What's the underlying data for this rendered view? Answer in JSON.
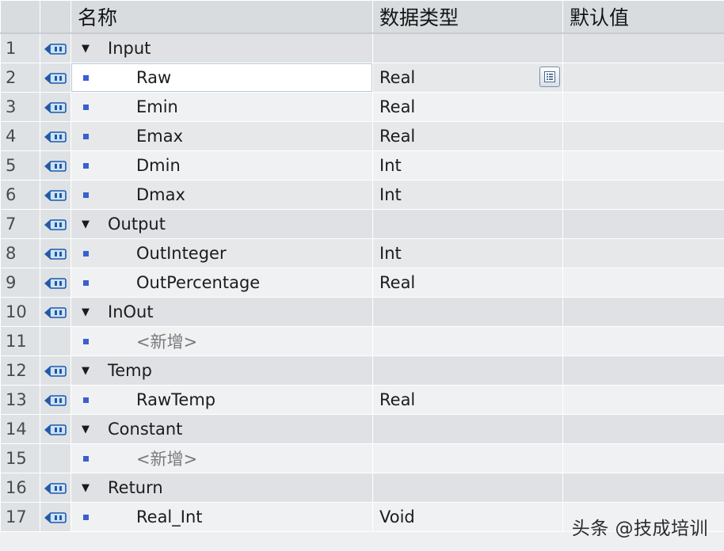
{
  "headers": {
    "name": "名称",
    "data_type": "数据类型",
    "default_value": "默认值"
  },
  "rows": [
    {
      "num": "1",
      "kind": "section",
      "name": "Input",
      "type": ""
    },
    {
      "num": "2",
      "kind": "var",
      "name": "Raw",
      "type": "Real",
      "selected": true
    },
    {
      "num": "3",
      "kind": "var",
      "name": "Emin",
      "type": "Real"
    },
    {
      "num": "4",
      "kind": "var",
      "name": "Emax",
      "type": "Real"
    },
    {
      "num": "5",
      "kind": "var",
      "name": "Dmin",
      "type": "Int"
    },
    {
      "num": "6",
      "kind": "var",
      "name": "Dmax",
      "type": "Int"
    },
    {
      "num": "7",
      "kind": "section",
      "name": "Output",
      "type": ""
    },
    {
      "num": "8",
      "kind": "var",
      "name": "OutInteger",
      "type": "Int"
    },
    {
      "num": "9",
      "kind": "var",
      "name": "OutPercentage",
      "type": "Real"
    },
    {
      "num": "10",
      "kind": "section",
      "name": "InOut",
      "type": ""
    },
    {
      "num": "11",
      "kind": "add",
      "name": "<新增>",
      "type": ""
    },
    {
      "num": "12",
      "kind": "section",
      "name": "Temp",
      "type": ""
    },
    {
      "num": "13",
      "kind": "var",
      "name": "RawTemp",
      "type": "Real"
    },
    {
      "num": "14",
      "kind": "section",
      "name": "Constant",
      "type": ""
    },
    {
      "num": "15",
      "kind": "add",
      "name": "<新增>",
      "type": ""
    },
    {
      "num": "16",
      "kind": "section",
      "name": "Return",
      "type": ""
    },
    {
      "num": "17",
      "kind": "var",
      "name": "Real_Int",
      "type": "Void"
    }
  ],
  "icons": {
    "interface": "interface-parameter-icon",
    "expand": "expand-triangle-icon",
    "member": "member-square-icon",
    "type_picker": "type-list-icon"
  },
  "colors": {
    "member_square": "#3a5fcf",
    "icon_blue": "#1e5aa8"
  },
  "watermark": "头条 @技成培训"
}
